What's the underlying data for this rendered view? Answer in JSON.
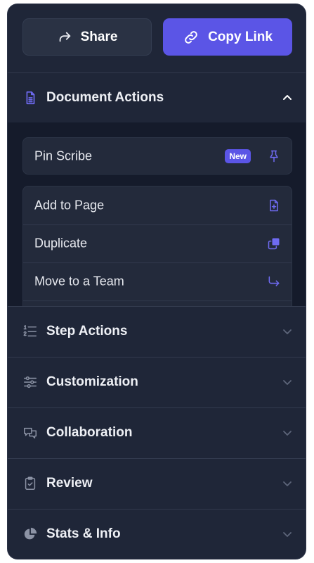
{
  "actions": {
    "share_label": "Share",
    "copy_link_label": "Copy Link"
  },
  "document_actions": {
    "title": "Document Actions",
    "pin": {
      "label": "Pin Scribe",
      "badge": "New"
    },
    "items": [
      {
        "label": "Add to Page",
        "icon": "add-document-icon"
      },
      {
        "label": "Duplicate",
        "icon": "duplicate-icon"
      },
      {
        "label": "Move to a Team",
        "icon": "move-arrow-icon"
      }
    ]
  },
  "sections": [
    {
      "label": "Step Actions",
      "icon": "numbered-list-icon"
    },
    {
      "label": "Customization",
      "icon": "sliders-icon"
    },
    {
      "label": "Collaboration",
      "icon": "chat-bubbles-icon"
    },
    {
      "label": "Review",
      "icon": "clipboard-check-icon"
    },
    {
      "label": "Stats & Info",
      "icon": "pie-chart-icon"
    }
  ],
  "colors": {
    "panel": "#1f2638",
    "accent": "#5b55e6",
    "expanded_body": "#151b2b",
    "muted_icon": "#8c93a5",
    "text": "#eef0f5"
  }
}
